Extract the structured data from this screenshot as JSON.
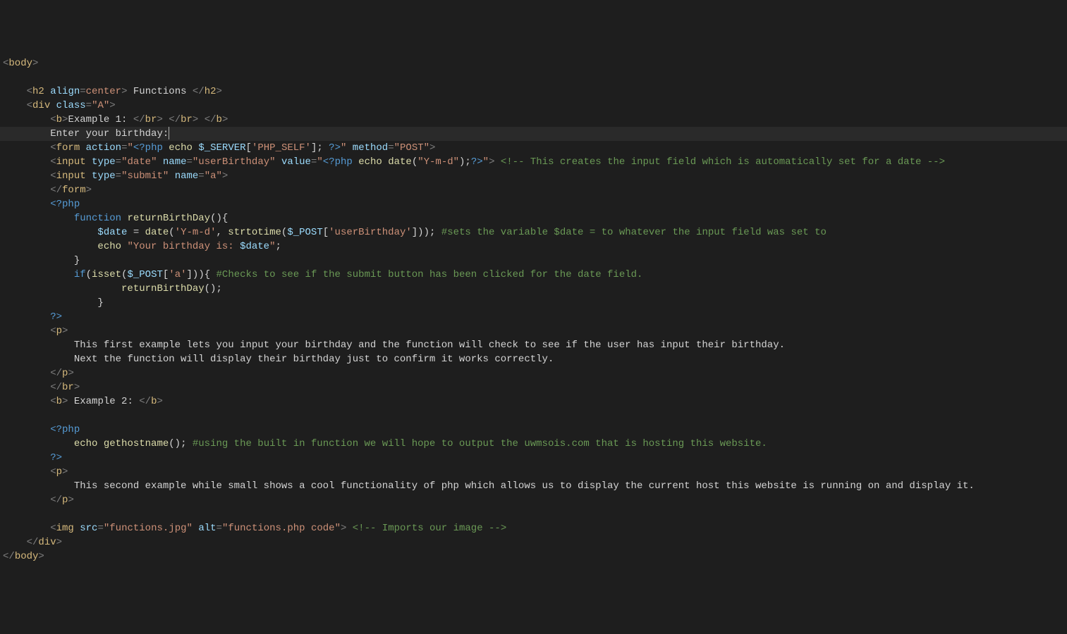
{
  "lines": [
    {
      "cls": "",
      "segments": [
        {
          "c": "t-tag",
          "t": "<"
        },
        {
          "c": "t-orange",
          "t": "body"
        },
        {
          "c": "t-tag",
          "t": ">"
        }
      ]
    },
    {
      "cls": "",
      "segments": []
    },
    {
      "cls": "",
      "segments": [
        {
          "c": "",
          "t": "    "
        },
        {
          "c": "t-tag",
          "t": "<"
        },
        {
          "c": "t-orange",
          "t": "h2"
        },
        {
          "c": "",
          "t": " "
        },
        {
          "c": "t-attr",
          "t": "align"
        },
        {
          "c": "t-tag",
          "t": "="
        },
        {
          "c": "t-val",
          "t": "center"
        },
        {
          "c": "t-tag",
          "t": ">"
        },
        {
          "c": "t-white",
          "t": " Functions "
        },
        {
          "c": "t-tag",
          "t": "</"
        },
        {
          "c": "t-orange",
          "t": "h2"
        },
        {
          "c": "t-tag",
          "t": ">"
        }
      ]
    },
    {
      "cls": "",
      "segments": [
        {
          "c": "",
          "t": "    "
        },
        {
          "c": "t-tag",
          "t": "<"
        },
        {
          "c": "t-orange",
          "t": "div"
        },
        {
          "c": "",
          "t": " "
        },
        {
          "c": "t-attr",
          "t": "class"
        },
        {
          "c": "t-tag",
          "t": "="
        },
        {
          "c": "t-val",
          "t": "\"A\""
        },
        {
          "c": "t-tag",
          "t": ">"
        }
      ]
    },
    {
      "cls": "",
      "segments": [
        {
          "c": "",
          "t": "        "
        },
        {
          "c": "t-tag",
          "t": "<"
        },
        {
          "c": "t-orange",
          "t": "b"
        },
        {
          "c": "t-tag",
          "t": ">"
        },
        {
          "c": "t-white",
          "t": "Example 1: "
        },
        {
          "c": "t-tag",
          "t": "</"
        },
        {
          "c": "t-orange",
          "t": "br"
        },
        {
          "c": "t-tag",
          "t": ">"
        },
        {
          "c": "",
          "t": " "
        },
        {
          "c": "t-tag",
          "t": "</"
        },
        {
          "c": "t-orange",
          "t": "br"
        },
        {
          "c": "t-tag",
          "t": ">"
        },
        {
          "c": "",
          "t": " "
        },
        {
          "c": "t-tag",
          "t": "</"
        },
        {
          "c": "t-orange",
          "t": "b"
        },
        {
          "c": "t-tag",
          "t": ">"
        }
      ]
    },
    {
      "cls": "hl",
      "cursor": true,
      "segments": [
        {
          "c": "",
          "t": "        "
        },
        {
          "c": "t-white",
          "t": "Enter your birthday:"
        }
      ]
    },
    {
      "cls": "",
      "segments": [
        {
          "c": "",
          "t": "        "
        },
        {
          "c": "t-tag",
          "t": "<"
        },
        {
          "c": "t-orange",
          "t": "form"
        },
        {
          "c": "",
          "t": " "
        },
        {
          "c": "t-attr",
          "t": "action"
        },
        {
          "c": "t-tag",
          "t": "="
        },
        {
          "c": "t-val",
          "t": "\""
        },
        {
          "c": "t-php",
          "t": "<?php"
        },
        {
          "c": "",
          "t": " "
        },
        {
          "c": "t-fn",
          "t": "echo"
        },
        {
          "c": "",
          "t": " "
        },
        {
          "c": "t-var",
          "t": "$_SERVER"
        },
        {
          "c": "t-white",
          "t": "["
        },
        {
          "c": "t-str",
          "t": "'PHP_SELF'"
        },
        {
          "c": "t-white",
          "t": "]; "
        },
        {
          "c": "t-php",
          "t": "?>"
        },
        {
          "c": "t-val",
          "t": "\""
        },
        {
          "c": "",
          "t": " "
        },
        {
          "c": "t-attr",
          "t": "method"
        },
        {
          "c": "t-tag",
          "t": "="
        },
        {
          "c": "t-val",
          "t": "\"POST\""
        },
        {
          "c": "t-tag",
          "t": ">"
        }
      ]
    },
    {
      "cls": "",
      "segments": [
        {
          "c": "",
          "t": "        "
        },
        {
          "c": "t-tag",
          "t": "<"
        },
        {
          "c": "t-orange",
          "t": "input"
        },
        {
          "c": "",
          "t": " "
        },
        {
          "c": "t-attr",
          "t": "type"
        },
        {
          "c": "t-tag",
          "t": "="
        },
        {
          "c": "t-val",
          "t": "\"date\""
        },
        {
          "c": "",
          "t": " "
        },
        {
          "c": "t-attr",
          "t": "name"
        },
        {
          "c": "t-tag",
          "t": "="
        },
        {
          "c": "t-val",
          "t": "\"userBirthday\""
        },
        {
          "c": "",
          "t": " "
        },
        {
          "c": "t-attr",
          "t": "value"
        },
        {
          "c": "t-tag",
          "t": "="
        },
        {
          "c": "t-val",
          "t": "\""
        },
        {
          "c": "t-php",
          "t": "<?php"
        },
        {
          "c": "",
          "t": " "
        },
        {
          "c": "t-fn",
          "t": "echo"
        },
        {
          "c": "",
          "t": " "
        },
        {
          "c": "t-fn",
          "t": "date"
        },
        {
          "c": "t-white",
          "t": "("
        },
        {
          "c": "t-str",
          "t": "\"Y-m-d\""
        },
        {
          "c": "t-white",
          "t": ");"
        },
        {
          "c": "t-php",
          "t": "?>"
        },
        {
          "c": "t-val",
          "t": "\""
        },
        {
          "c": "t-tag",
          "t": ">"
        },
        {
          "c": "",
          "t": " "
        },
        {
          "c": "t-comment",
          "t": "<!-- This creates the input field which is automatically set for a date -->"
        }
      ]
    },
    {
      "cls": "",
      "segments": [
        {
          "c": "",
          "t": "        "
        },
        {
          "c": "t-tag",
          "t": "<"
        },
        {
          "c": "t-orange",
          "t": "input"
        },
        {
          "c": "",
          "t": " "
        },
        {
          "c": "t-attr",
          "t": "type"
        },
        {
          "c": "t-tag",
          "t": "="
        },
        {
          "c": "t-val",
          "t": "\"submit\""
        },
        {
          "c": "",
          "t": " "
        },
        {
          "c": "t-attr",
          "t": "name"
        },
        {
          "c": "t-tag",
          "t": "="
        },
        {
          "c": "t-val",
          "t": "\"a\""
        },
        {
          "c": "t-tag",
          "t": ">"
        }
      ]
    },
    {
      "cls": "",
      "segments": [
        {
          "c": "",
          "t": "        "
        },
        {
          "c": "t-tag",
          "t": "</"
        },
        {
          "c": "t-orange",
          "t": "form"
        },
        {
          "c": "t-tag",
          "t": ">"
        }
      ]
    },
    {
      "cls": "",
      "segments": [
        {
          "c": "",
          "t": "        "
        },
        {
          "c": "t-php",
          "t": "<?php"
        }
      ]
    },
    {
      "cls": "",
      "segments": [
        {
          "c": "",
          "t": "            "
        },
        {
          "c": "t-kw",
          "t": "function"
        },
        {
          "c": "",
          "t": " "
        },
        {
          "c": "t-fn",
          "t": "returnBirthDay"
        },
        {
          "c": "t-white",
          "t": "(){"
        }
      ]
    },
    {
      "cls": "",
      "segments": [
        {
          "c": "",
          "t": "                "
        },
        {
          "c": "t-var",
          "t": "$date"
        },
        {
          "c": "t-white",
          "t": " = "
        },
        {
          "c": "t-fn",
          "t": "date"
        },
        {
          "c": "t-white",
          "t": "("
        },
        {
          "c": "t-str",
          "t": "'Y-m-d'"
        },
        {
          "c": "t-white",
          "t": ", "
        },
        {
          "c": "t-fn",
          "t": "strtotime"
        },
        {
          "c": "t-white",
          "t": "("
        },
        {
          "c": "t-var",
          "t": "$_POST"
        },
        {
          "c": "t-white",
          "t": "["
        },
        {
          "c": "t-str",
          "t": "'userBirthday'"
        },
        {
          "c": "t-white",
          "t": "])); "
        },
        {
          "c": "t-comment",
          "t": "#sets the variable $date = to whatever the input field was set to"
        }
      ]
    },
    {
      "cls": "",
      "segments": [
        {
          "c": "",
          "t": "                "
        },
        {
          "c": "t-fn",
          "t": "echo"
        },
        {
          "c": "",
          "t": " "
        },
        {
          "c": "t-str",
          "t": "\"Your birthday is: "
        },
        {
          "c": "t-var",
          "t": "$date"
        },
        {
          "c": "t-str",
          "t": "\""
        },
        {
          "c": "t-white",
          "t": ";"
        }
      ]
    },
    {
      "cls": "",
      "segments": [
        {
          "c": "",
          "t": "            "
        },
        {
          "c": "t-white",
          "t": "}"
        }
      ]
    },
    {
      "cls": "",
      "segments": [
        {
          "c": "",
          "t": "            "
        },
        {
          "c": "t-kw",
          "t": "if"
        },
        {
          "c": "t-white",
          "t": "("
        },
        {
          "c": "t-fn",
          "t": "isset"
        },
        {
          "c": "t-white",
          "t": "("
        },
        {
          "c": "t-var",
          "t": "$_POST"
        },
        {
          "c": "t-white",
          "t": "["
        },
        {
          "c": "t-str",
          "t": "'a'"
        },
        {
          "c": "t-white",
          "t": "])){ "
        },
        {
          "c": "t-comment",
          "t": "#Checks to see if the submit button has been clicked for the date field."
        }
      ]
    },
    {
      "cls": "",
      "segments": [
        {
          "c": "",
          "t": "                    "
        },
        {
          "c": "t-fn",
          "t": "returnBirthDay"
        },
        {
          "c": "t-white",
          "t": "();"
        }
      ]
    },
    {
      "cls": "",
      "segments": [
        {
          "c": "",
          "t": "                "
        },
        {
          "c": "t-white",
          "t": "}"
        }
      ]
    },
    {
      "cls": "",
      "segments": [
        {
          "c": "",
          "t": "        "
        },
        {
          "c": "t-php",
          "t": "?>"
        }
      ]
    },
    {
      "cls": "",
      "segments": [
        {
          "c": "",
          "t": "        "
        },
        {
          "c": "t-tag",
          "t": "<"
        },
        {
          "c": "t-orange",
          "t": "p"
        },
        {
          "c": "t-tag",
          "t": ">"
        }
      ]
    },
    {
      "cls": "",
      "segments": [
        {
          "c": "",
          "t": "            "
        },
        {
          "c": "t-white",
          "t": "This first example lets you input your birthday and the function will check to see if the user has input their birthday."
        }
      ]
    },
    {
      "cls": "",
      "segments": [
        {
          "c": "",
          "t": "            "
        },
        {
          "c": "t-white",
          "t": "Next the function will display their birthday just to confirm it works correctly."
        }
      ]
    },
    {
      "cls": "",
      "segments": [
        {
          "c": "",
          "t": "        "
        },
        {
          "c": "t-tag",
          "t": "</"
        },
        {
          "c": "t-orange",
          "t": "p"
        },
        {
          "c": "t-tag",
          "t": ">"
        }
      ]
    },
    {
      "cls": "",
      "segments": [
        {
          "c": "",
          "t": "        "
        },
        {
          "c": "t-tag",
          "t": "</"
        },
        {
          "c": "t-orange",
          "t": "br"
        },
        {
          "c": "t-tag",
          "t": ">"
        }
      ]
    },
    {
      "cls": "",
      "segments": [
        {
          "c": "",
          "t": "        "
        },
        {
          "c": "t-tag",
          "t": "<"
        },
        {
          "c": "t-orange",
          "t": "b"
        },
        {
          "c": "t-tag",
          "t": ">"
        },
        {
          "c": "t-white",
          "t": " Example 2: "
        },
        {
          "c": "t-tag",
          "t": "</"
        },
        {
          "c": "t-orange",
          "t": "b"
        },
        {
          "c": "t-tag",
          "t": ">"
        }
      ]
    },
    {
      "cls": "",
      "segments": []
    },
    {
      "cls": "",
      "segments": [
        {
          "c": "",
          "t": "        "
        },
        {
          "c": "t-php",
          "t": "<?php"
        }
      ]
    },
    {
      "cls": "",
      "segments": [
        {
          "c": "",
          "t": "            "
        },
        {
          "c": "t-fn",
          "t": "echo"
        },
        {
          "c": "",
          "t": " "
        },
        {
          "c": "t-fn",
          "t": "gethostname"
        },
        {
          "c": "t-white",
          "t": "(); "
        },
        {
          "c": "t-comment",
          "t": "#using the built in function we will hope to output the uwmsois.com that is hosting this website."
        }
      ]
    },
    {
      "cls": "",
      "segments": [
        {
          "c": "",
          "t": "        "
        },
        {
          "c": "t-php",
          "t": "?>"
        }
      ]
    },
    {
      "cls": "",
      "segments": [
        {
          "c": "",
          "t": "        "
        },
        {
          "c": "t-tag",
          "t": "<"
        },
        {
          "c": "t-orange",
          "t": "p"
        },
        {
          "c": "t-tag",
          "t": ">"
        }
      ]
    },
    {
      "cls": "",
      "segments": [
        {
          "c": "",
          "t": "            "
        },
        {
          "c": "t-white",
          "t": "This second example while small shows a cool functionality of php which allows us to display the current host this website is running on and display it."
        }
      ]
    },
    {
      "cls": "",
      "segments": [
        {
          "c": "",
          "t": "        "
        },
        {
          "c": "t-tag",
          "t": "</"
        },
        {
          "c": "t-orange",
          "t": "p"
        },
        {
          "c": "t-tag",
          "t": ">"
        }
      ]
    },
    {
      "cls": "",
      "segments": []
    },
    {
      "cls": "",
      "segments": [
        {
          "c": "",
          "t": "        "
        },
        {
          "c": "t-tag",
          "t": "<"
        },
        {
          "c": "t-orange",
          "t": "img"
        },
        {
          "c": "",
          "t": " "
        },
        {
          "c": "t-attr",
          "t": "src"
        },
        {
          "c": "t-tag",
          "t": "="
        },
        {
          "c": "t-val",
          "t": "\"functions.jpg\""
        },
        {
          "c": "",
          "t": " "
        },
        {
          "c": "t-attr",
          "t": "alt"
        },
        {
          "c": "t-tag",
          "t": "="
        },
        {
          "c": "t-val",
          "t": "\"functions.php code\""
        },
        {
          "c": "t-tag",
          "t": ">"
        },
        {
          "c": "",
          "t": " "
        },
        {
          "c": "t-comment",
          "t": "<!-- Imports our image -->"
        }
      ]
    },
    {
      "cls": "",
      "segments": [
        {
          "c": "",
          "t": "    "
        },
        {
          "c": "t-tag",
          "t": "</"
        },
        {
          "c": "t-orange",
          "t": "div"
        },
        {
          "c": "t-tag",
          "t": ">"
        }
      ]
    },
    {
      "cls": "",
      "segments": [
        {
          "c": "t-tag",
          "t": "</"
        },
        {
          "c": "t-orange",
          "t": "body"
        },
        {
          "c": "t-tag",
          "t": ">"
        }
      ]
    }
  ]
}
